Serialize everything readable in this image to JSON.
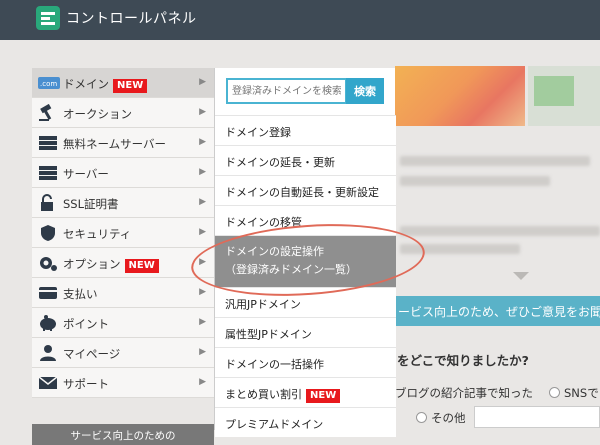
{
  "header": {
    "title": "コントロールパネル"
  },
  "sidebar": {
    "items": [
      {
        "label": "ドメイン",
        "badge": "NEW",
        "icon": "com-icon"
      },
      {
        "label": "オークション",
        "icon": "gavel-icon"
      },
      {
        "label": "無料ネームサーバー",
        "icon": "server-icon"
      },
      {
        "label": "サーバー",
        "icon": "server-icon"
      },
      {
        "label": "SSL証明書",
        "icon": "lock-icon"
      },
      {
        "label": "セキュリティ",
        "icon": "shield-icon"
      },
      {
        "label": "オプション",
        "badge": "NEW",
        "icon": "gear-icon"
      },
      {
        "label": "支払い",
        "icon": "card-icon"
      },
      {
        "label": "ポイント",
        "icon": "piggy-icon"
      },
      {
        "label": "マイページ",
        "icon": "user-icon"
      },
      {
        "label": "サポート",
        "icon": "mail-icon"
      }
    ],
    "footer_text": "サービス向上のための"
  },
  "dropdown": {
    "search_placeholder": "登録済みドメインを検索",
    "search_button": "検索",
    "items": [
      {
        "label": "ドメイン登録"
      },
      {
        "label": "ドメインの延長・更新"
      },
      {
        "label": "ドメインの自動延長・更新設定"
      },
      {
        "label": "ドメインの移管"
      },
      {
        "label": "ドメインの設定操作",
        "sub": "（登録済みドメイン一覧）"
      },
      {
        "label": "汎用JPドメイン"
      },
      {
        "label": "属性型JPドメイン"
      },
      {
        "label": "ドメインの一括操作"
      },
      {
        "label": "まとめ買い割引",
        "badge": "NEW"
      },
      {
        "label": "プレミアムドメイン"
      }
    ]
  },
  "background": {
    "banner_text": "ービス向上のため、ぜひご意見をお聞",
    "question": "をどこで知りましたか?",
    "option_blog": "ブログの紹介記事で知った",
    "option_sns": "SNSで",
    "option_other": "その他"
  },
  "colors": {
    "header": "#3e4a55",
    "accent": "#32a6cb",
    "badge": "#e8191d",
    "annotation": "#e06a58"
  }
}
